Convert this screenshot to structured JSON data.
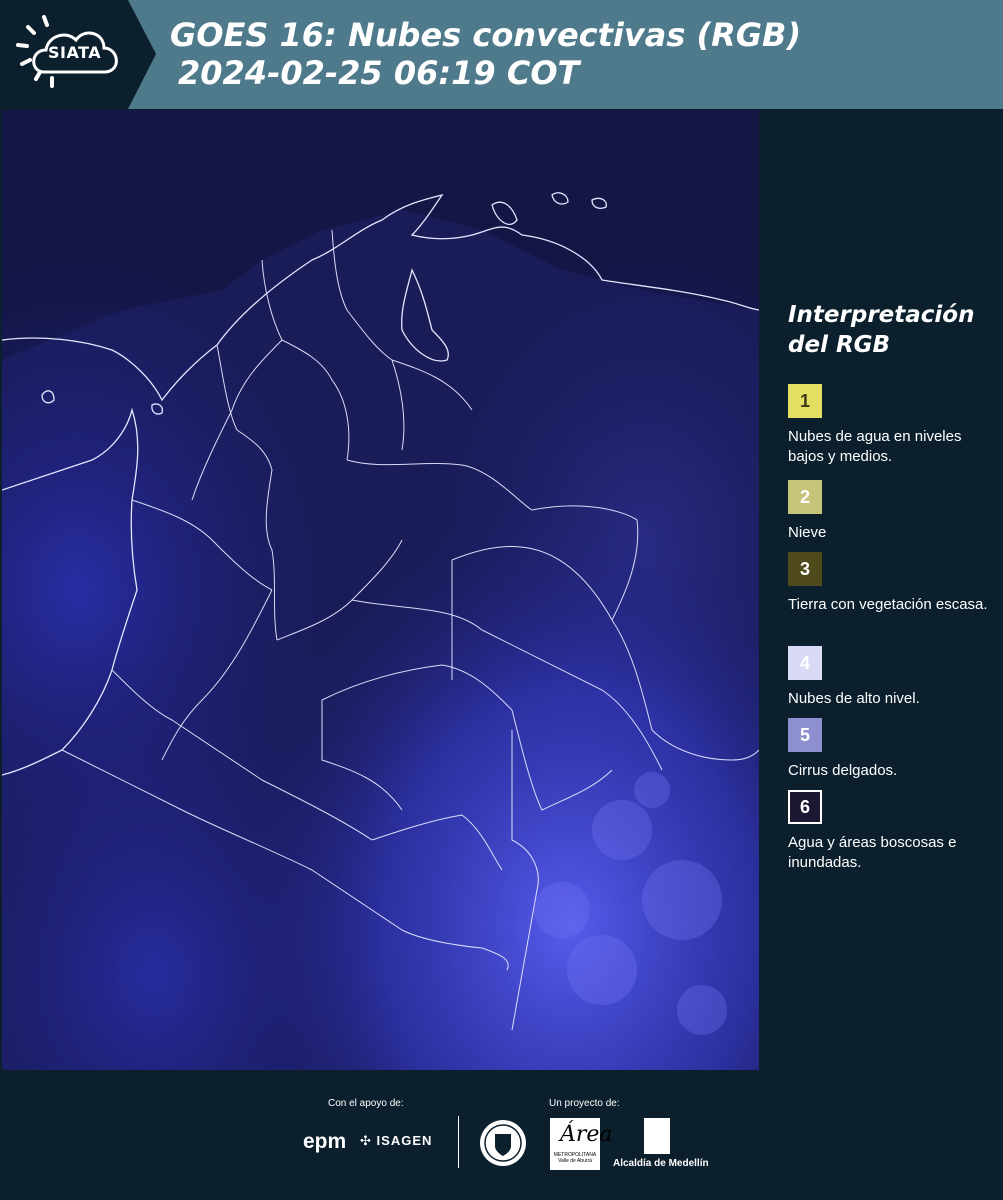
{
  "header": {
    "logo": "SIATA",
    "title_line1": "GOES 16: Nubes convectivas (RGB)",
    "title_line2": "2024-02-25 06:19 COT",
    "colors": {
      "bar": "#4e7a8c",
      "logo_block": "#0b1f2c"
    }
  },
  "map": {
    "icon": "satellite-map",
    "colors": {
      "ocean": "#131542",
      "land": "#1b1c5a",
      "cloud": "#4a50e8",
      "borders": "#dfe3ff"
    }
  },
  "legend": {
    "title_line1": "Interpretación",
    "title_line2": "del RGB",
    "items": [
      {
        "number": "1",
        "label": "Nubes de agua en niveles bajos y medios.",
        "color": "#e3df62"
      },
      {
        "number": "2",
        "label": "Nieve",
        "color": "#c7c47a"
      },
      {
        "number": "3",
        "label": "Tierra con vegetación escasa.",
        "color": "#4f4a1c"
      },
      {
        "number": "4",
        "label": "Nubes de alto nivel.",
        "color": "#d9daf6"
      },
      {
        "number": "5",
        "label": "Cirrus delgados.",
        "color": "#8d8fcf"
      },
      {
        "number": "6",
        "label": "Agua y áreas boscosas e inundadas.",
        "color": "#1c1833"
      }
    ]
  },
  "footer": {
    "support_label": "Con el apoyo de:",
    "project_label": "Un proyecto de:",
    "sponsors": [
      "epm",
      "ISAGEN"
    ],
    "partners": {
      "area_script": "Área",
      "area_sub": "METROPOLITANA Valle de Aburrá",
      "alcaldia": "Alcaldía de Medellín"
    }
  }
}
